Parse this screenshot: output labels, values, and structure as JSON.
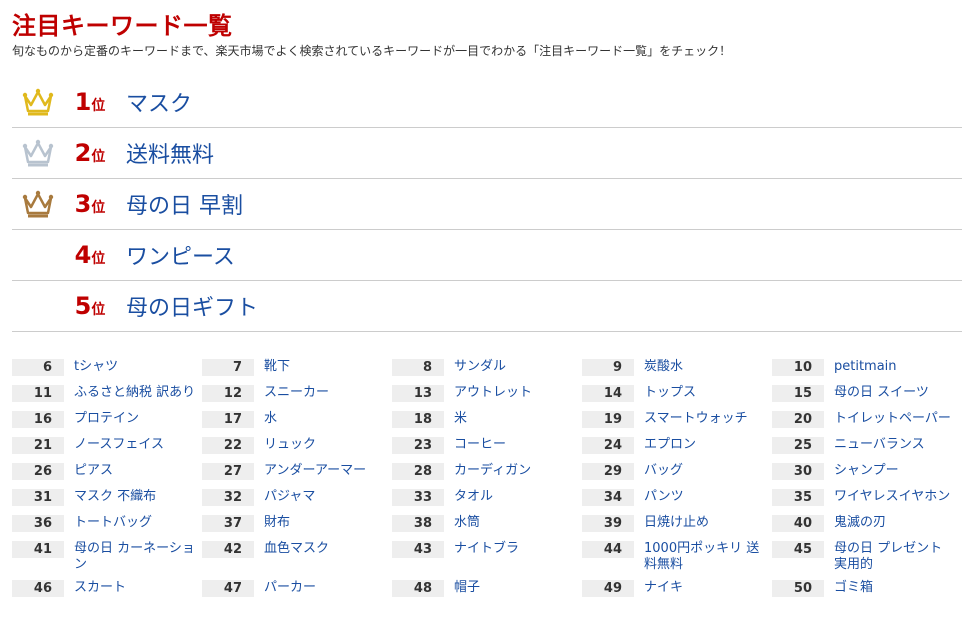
{
  "header": {
    "title": "注目キーワード一覧",
    "subtitle": "旬なものから定番のキーワードまで、楽天市場でよく検索されているキーワードが一目でわかる「注目キーワード一覧」をチェック！"
  },
  "colors": {
    "accent": "#bf0000",
    "link": "#1a4ea1",
    "gold": "#e0b91d",
    "silver": "#b8c3cf",
    "bronze": "#a87a3e"
  },
  "top_ranks": [
    {
      "rank": "1",
      "suffix": "位",
      "keyword": "マスク",
      "crown": "gold-crown-icon"
    },
    {
      "rank": "2",
      "suffix": "位",
      "keyword": "送料無料",
      "crown": "silver-crown-icon"
    },
    {
      "rank": "3",
      "suffix": "位",
      "keyword": "母の日 早割",
      "crown": "bronze-crown-icon"
    },
    {
      "rank": "4",
      "suffix": "位",
      "keyword": "ワンピース"
    },
    {
      "rank": "5",
      "suffix": "位",
      "keyword": "母の日ギフト"
    }
  ],
  "rank_list": [
    {
      "rank": "6",
      "keyword": "tシャツ"
    },
    {
      "rank": "7",
      "keyword": "靴下"
    },
    {
      "rank": "8",
      "keyword": "サンダル"
    },
    {
      "rank": "9",
      "keyword": "炭酸水"
    },
    {
      "rank": "10",
      "keyword": "petitmain"
    },
    {
      "rank": "11",
      "keyword": "ふるさと納税 訳あり"
    },
    {
      "rank": "12",
      "keyword": "スニーカー"
    },
    {
      "rank": "13",
      "keyword": "アウトレット"
    },
    {
      "rank": "14",
      "keyword": "トップス"
    },
    {
      "rank": "15",
      "keyword": "母の日 スイーツ"
    },
    {
      "rank": "16",
      "keyword": "プロテイン"
    },
    {
      "rank": "17",
      "keyword": "水"
    },
    {
      "rank": "18",
      "keyword": "米"
    },
    {
      "rank": "19",
      "keyword": "スマートウォッチ"
    },
    {
      "rank": "20",
      "keyword": "トイレットペーパー"
    },
    {
      "rank": "21",
      "keyword": "ノースフェイス"
    },
    {
      "rank": "22",
      "keyword": "リュック"
    },
    {
      "rank": "23",
      "keyword": "コーヒー"
    },
    {
      "rank": "24",
      "keyword": "エプロン"
    },
    {
      "rank": "25",
      "keyword": "ニューバランス"
    },
    {
      "rank": "26",
      "keyword": "ピアス"
    },
    {
      "rank": "27",
      "keyword": "アンダーアーマー"
    },
    {
      "rank": "28",
      "keyword": "カーディガン"
    },
    {
      "rank": "29",
      "keyword": "バッグ"
    },
    {
      "rank": "30",
      "keyword": "シャンプー"
    },
    {
      "rank": "31",
      "keyword": "マスク 不織布"
    },
    {
      "rank": "32",
      "keyword": "パジャマ"
    },
    {
      "rank": "33",
      "keyword": "タオル"
    },
    {
      "rank": "34",
      "keyword": "パンツ"
    },
    {
      "rank": "35",
      "keyword": "ワイヤレスイヤホン"
    },
    {
      "rank": "36",
      "keyword": "トートバッグ"
    },
    {
      "rank": "37",
      "keyword": "財布"
    },
    {
      "rank": "38",
      "keyword": "水筒"
    },
    {
      "rank": "39",
      "keyword": "日焼け止め"
    },
    {
      "rank": "40",
      "keyword": "鬼滅の刃"
    },
    {
      "rank": "41",
      "keyword": "母の日 カーネーション"
    },
    {
      "rank": "42",
      "keyword": "血色マスク"
    },
    {
      "rank": "43",
      "keyword": "ナイトブラ"
    },
    {
      "rank": "44",
      "keyword": "1000円ポッキリ 送料無料"
    },
    {
      "rank": "45",
      "keyword": "母の日 プレゼント 実用的"
    },
    {
      "rank": "46",
      "keyword": "スカート"
    },
    {
      "rank": "47",
      "keyword": "パーカー"
    },
    {
      "rank": "48",
      "keyword": "帽子"
    },
    {
      "rank": "49",
      "keyword": "ナイキ"
    },
    {
      "rank": "50",
      "keyword": "ゴミ箱"
    }
  ]
}
